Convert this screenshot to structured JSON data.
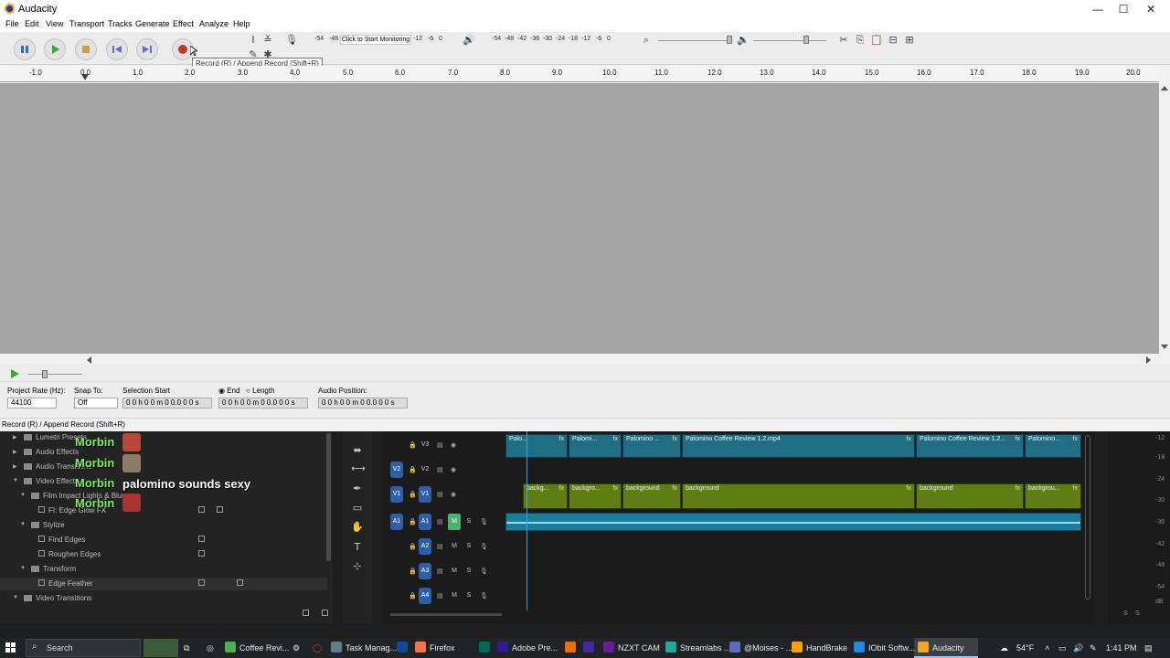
{
  "window": {
    "title": "Audacity",
    "controls": [
      "—",
      "☐",
      "✕"
    ]
  },
  "menu": [
    "File",
    "Edit",
    "View",
    "Transport",
    "Tracks",
    "Generate",
    "Effect",
    "Analyze",
    "Help"
  ],
  "toolbar": {
    "record_meter_scale": "-54   -48",
    "monitor_label": "Click to Start Monitoring",
    "record_meter_scale2": "-12   -6   0",
    "play_meter_scale": "-54  -48  -42  -36  -30  -24  -18  -12   -6   0",
    "tooltip": "Record (R) / Append Record (Shift+R)"
  },
  "ruler": [
    "-1.0",
    "0.0",
    "1.0",
    "2.0",
    "3.0",
    "4.0",
    "5.0",
    "6.0",
    "7.0",
    "8.0",
    "9.0",
    "10.0",
    "11.0",
    "12.0",
    "13.0",
    "14.0",
    "15.0",
    "16.0",
    "17.0",
    "18.0",
    "19.0",
    "20.0"
  ],
  "selection": {
    "project_rate_label": "Project Rate (Hz):",
    "project_rate": "44100",
    "snap_label": "Snap To:",
    "snap": "Off",
    "start_label": "Selection Start",
    "end_label": "End",
    "length_label": "Length",
    "start": "0 0 h 0 0 m 0 0.0 0 0 s",
    "end": "0 0 h 0 0 m 0 0.0 0 0 s",
    "audio_pos_label": "Audio Position:",
    "audio_pos": "0 0 h 0 0 m 0 0.0 0 0 s"
  },
  "status": "Record (R) / Append Record (Shift+R)",
  "premiere": {
    "effects": {
      "lumetri": "Lumetri Presets",
      "audio_effects": "Audio Effects",
      "audio_transitions": "Audio Transitions",
      "video_effects": "Video Effects",
      "film_impact": "Film Impact Lights & Blurs",
      "fi_edge_glow": "FI: Edge Glow FX",
      "stylize": "Stylize",
      "find_edges": "Find Edges",
      "roughen_edges": "Roughen Edges",
      "transform": "Transform",
      "edge_feather": "Edge Feather",
      "video_transitions": "Video Transitions"
    },
    "overlay": {
      "morbin": "Morbin",
      "caption": "palomino sounds sexy"
    },
    "tracks": {
      "v3": "V3",
      "v2": "V2",
      "v1": "V1",
      "a1": "A1",
      "a2": "A2",
      "a3": "A3",
      "a4": "A4",
      "m": "M",
      "s": "S"
    },
    "v3_clips": [
      "Palo...",
      "Palomi...",
      "Palomino ...",
      "Palomino Coffee Review 1.2.mp4",
      "Palomino Coffee Review 1.2...",
      "Palomino..."
    ],
    "v1_clips": [
      "backg...",
      "backgro...",
      "background",
      "background",
      "background",
      "backgrou..."
    ],
    "fx": "fx",
    "meter": [
      "-12",
      "-18",
      "-24",
      "-30",
      "-36",
      "-42",
      "-48",
      "-54",
      "dB"
    ],
    "meter_bottom": [
      "S",
      "S"
    ]
  },
  "taskbar": {
    "search": "Search",
    "items": [
      "Coffee Revi...",
      "Task Manag...",
      "Firefox",
      "Adobe Pre...",
      "NZXT CAM",
      "Streamlabs ...",
      "@Moises - ...",
      "HandBrake",
      "IObit Softw...",
      "Audacity"
    ],
    "weather": "54°F",
    "time": "1:41 PM"
  },
  "colors": {
    "accent_blue": "#2d5fa8",
    "morbin_green": "#7cf05a",
    "clip_teal": "#1f6e84",
    "clip_olive": "#5f7d12"
  }
}
